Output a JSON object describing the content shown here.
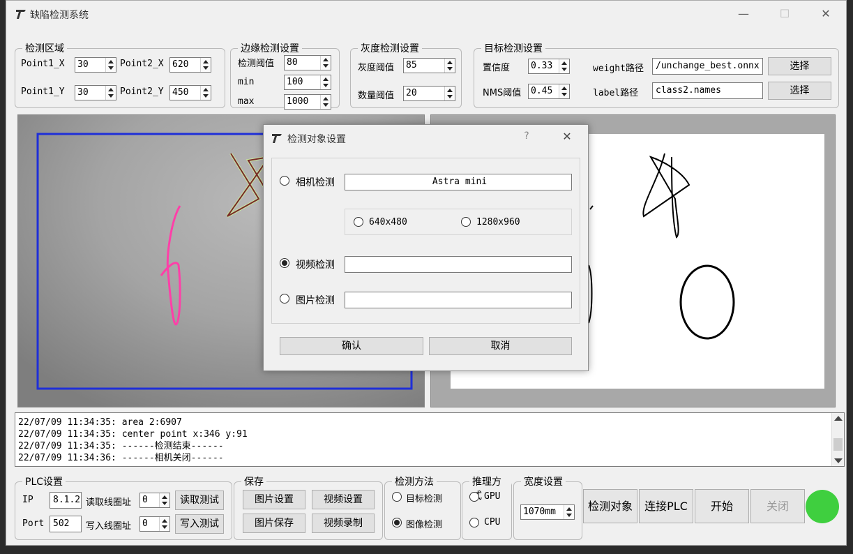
{
  "window": {
    "title": "缺陷检测系统",
    "minimize": "—",
    "maximize": "☐",
    "close": "✕"
  },
  "detect_region": {
    "legend": "检测区域",
    "p1x_label": "Point1_X",
    "p1x_value": "30",
    "p2x_label": "Point2_X",
    "p2x_value": "620",
    "p1y_label": "Point1_Y",
    "p1y_value": "30",
    "p2y_label": "Point2_Y",
    "p2y_value": "450"
  },
  "edge_detect": {
    "legend": "边缘检测设置",
    "threshold_label": "检测阈值",
    "threshold_value": "80",
    "min_label": "min",
    "min_value": "100",
    "max_label": "max",
    "max_value": "1000"
  },
  "gray_detect": {
    "legend": "灰度检测设置",
    "gray_label": "灰度阈值",
    "gray_value": "85",
    "count_label": "数量阈值",
    "count_value": "20"
  },
  "target_detect": {
    "legend": "目标检测设置",
    "conf_label": "置信度",
    "conf_value": "0.33",
    "nms_label": "NMS阈值",
    "nms_value": "0.45",
    "weight_label": "weight路径",
    "weight_value": "/unchange_best.onnx",
    "label_label": "label路径",
    "label_value": "class2.names",
    "select1": "选择",
    "select2": "选择"
  },
  "log": {
    "lines": [
      "22/07/09 11:34:35: area 2:6907",
      "22/07/09 11:34:35: center point x:346 y:91",
      "22/07/09 11:34:35: ------检测结束------",
      "22/07/09 11:34:36: ------相机关闭------"
    ]
  },
  "plc": {
    "legend": "PLC设置",
    "ip_label": "IP",
    "ip_value": "8.1.2",
    "read_label": "读取线圈址",
    "read_value": "0",
    "read_test": "读取测试",
    "port_label": "Port",
    "port_value": "502",
    "write_label": "写入线圈址",
    "write_value": "0",
    "write_test": "写入测试"
  },
  "save": {
    "legend": "保存",
    "image_settings": "图片设置",
    "video_settings": "视频设置",
    "image_save": "图片保存",
    "video_record": "视频录制"
  },
  "method": {
    "legend": "检测方法",
    "target": "目标检测",
    "image": "图像检测"
  },
  "inference": {
    "legend": "推理方式",
    "opt1": "GPU",
    "opt2": "CPU"
  },
  "width": {
    "legend": "宽度设置",
    "value": "1070mm"
  },
  "actions": {
    "detect_object": "检测对象",
    "connect_plc": "连接PLC",
    "start": "开始",
    "close": "关闭"
  },
  "status_color": "#3fcf3f",
  "dialog": {
    "title": "检测对象设置",
    "help": "?",
    "close": "✕",
    "camera_label": "相机检测",
    "camera_value": "Astra mini",
    "res1": "640x480",
    "res2": "1280x960",
    "video_label": "视频检测",
    "video_value": "",
    "image_label": "图片检测",
    "image_value": "",
    "ok": "确认",
    "cancel": "取消"
  }
}
